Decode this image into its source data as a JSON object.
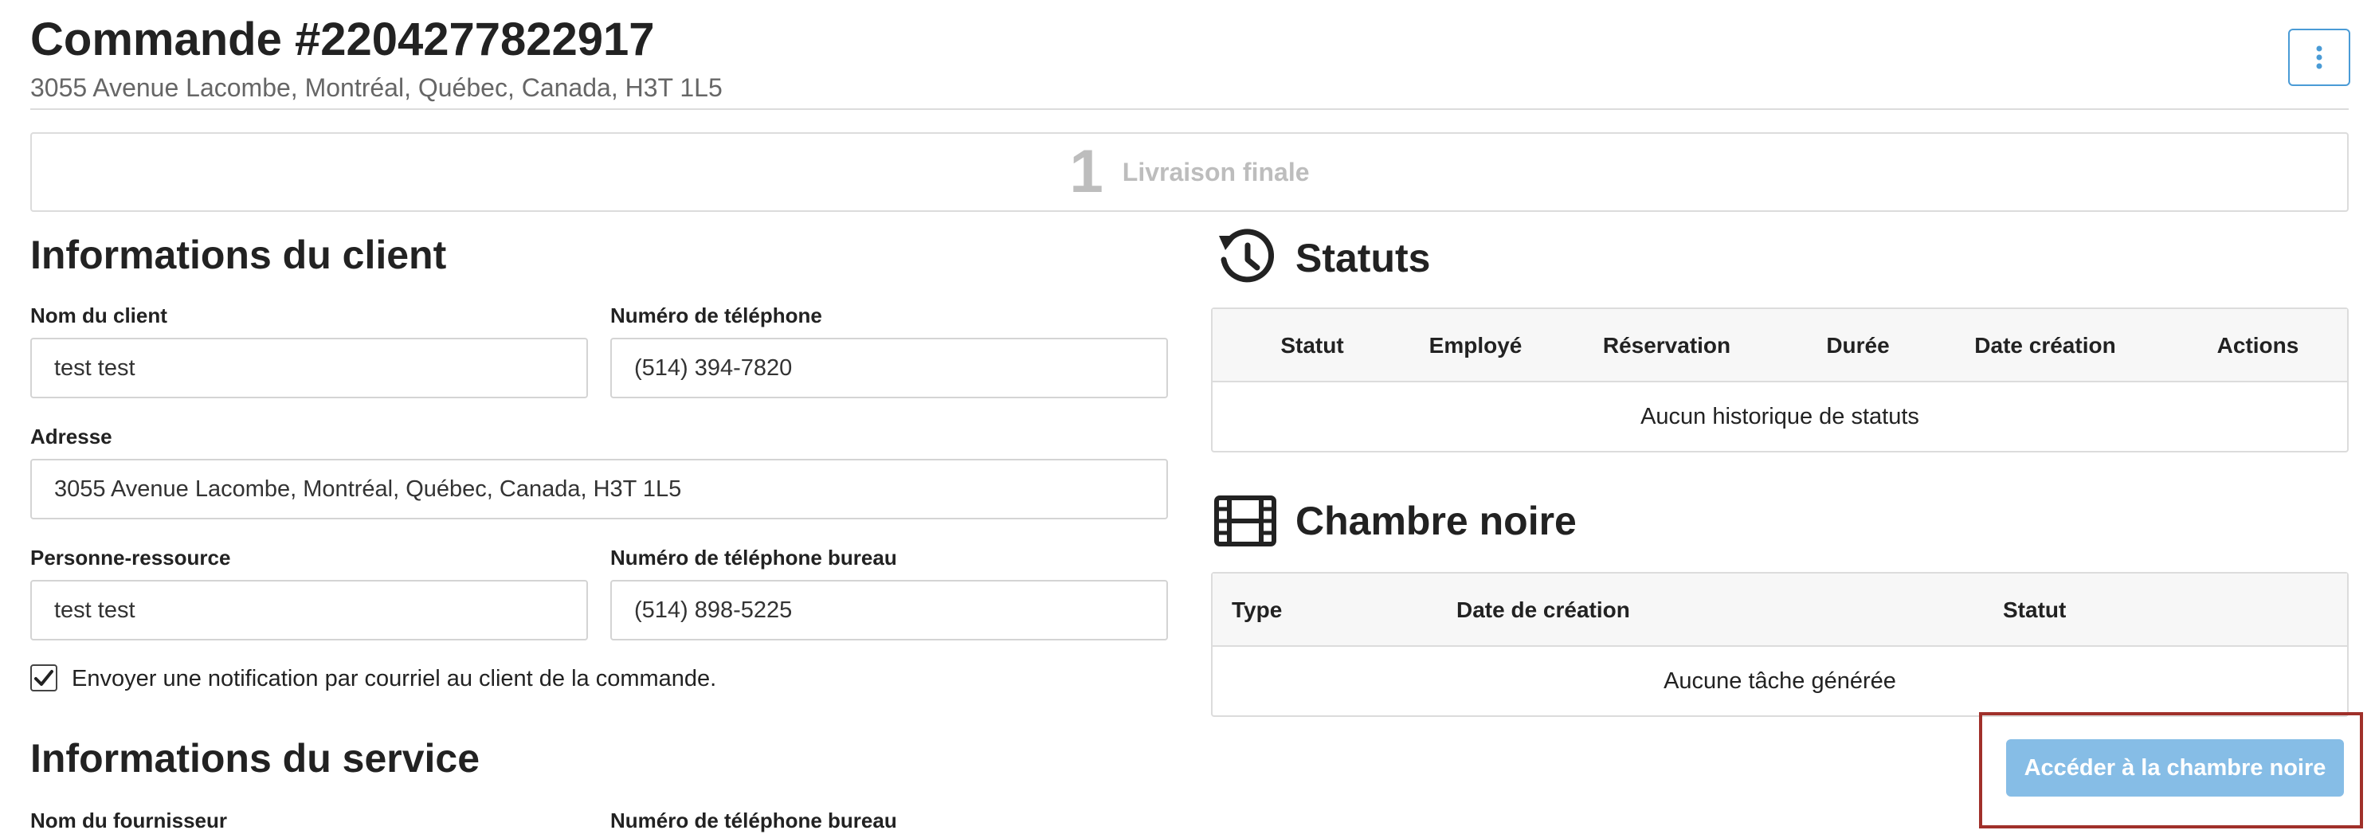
{
  "header": {
    "title": "Commande #2204277822917",
    "subtitle": "3055 Avenue Lacombe, Montréal, Québec, Canada, H3T 1L5",
    "menu_icon": "vertical-ellipsis-icon"
  },
  "step": {
    "number": "1",
    "label": "Livraison finale"
  },
  "client": {
    "title": "Informations du client",
    "name_label": "Nom du client",
    "name_value": "test test",
    "phone_label": "Numéro de téléphone",
    "phone_value": "(514) 394-7820",
    "address_label": "Adresse",
    "address_value": "3055 Avenue Lacombe, Montréal, Québec, Canada, H3T 1L5",
    "contact_label": "Personne-ressource",
    "contact_value": "test test",
    "office_phone_label": "Numéro de téléphone bureau",
    "office_phone_value": "(514) 898-5225",
    "notify_label": "Envoyer une notification par courriel au client de la commande.",
    "notify_checked": true
  },
  "service": {
    "title": "Informations du service",
    "supplier_label": "Nom du fournisseur",
    "office_phone_label": "Numéro de téléphone bureau"
  },
  "statuts": {
    "title": "Statuts",
    "icon": "history-icon",
    "columns": [
      "Statut",
      "Employé",
      "Réservation",
      "Durée",
      "Date création",
      "Actions"
    ],
    "empty": "Aucun historique de statuts"
  },
  "chambre": {
    "title": "Chambre noire",
    "icon": "film-icon",
    "columns": [
      "Type",
      "Date de création",
      "Statut"
    ],
    "empty": "Aucune tâche générée",
    "button_label": "Accéder à la chambre noire"
  },
  "colors": {
    "accent": "#4a9bd6",
    "button_bg": "#86bde6",
    "highlight_border": "#a0302a"
  }
}
